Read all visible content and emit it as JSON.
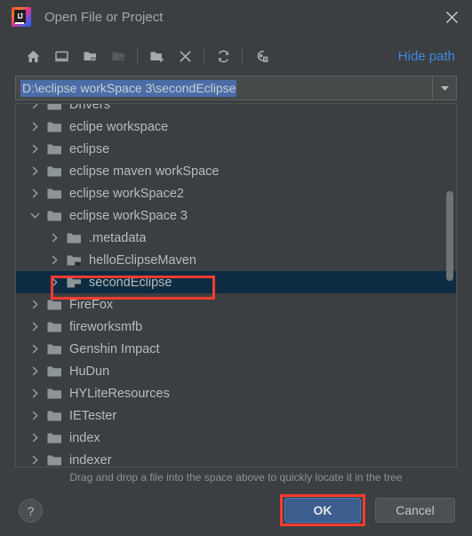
{
  "window": {
    "title": "Open File or Project",
    "logo_text": "IJ",
    "close_icon": "close-icon"
  },
  "toolbar": {
    "items": [
      {
        "name": "home-icon",
        "tooltip": "Home",
        "disabled": false
      },
      {
        "name": "desktop-icon",
        "tooltip": "Desktop",
        "disabled": false
      },
      {
        "name": "folder-up-icon",
        "tooltip": "Up",
        "disabled": false
      },
      {
        "name": "folder-icon",
        "tooltip": "Project Directory",
        "disabled": true
      },
      {
        "name": "new-folder-icon",
        "tooltip": "New Folder",
        "disabled": false
      },
      {
        "name": "delete-icon",
        "tooltip": "Delete",
        "disabled": false
      },
      {
        "name": "refresh-icon",
        "tooltip": "Refresh",
        "disabled": false
      },
      {
        "name": "show-hidden-files-icon",
        "tooltip": "Show Hidden Files",
        "disabled": false
      }
    ],
    "hide_path_label": "Hide path"
  },
  "path_field": {
    "value": "D:\\eclipse workSpace 3\\secondEclipse",
    "placeholder": "",
    "selected": true,
    "dropdown_icon": "chevron-down-icon"
  },
  "tree": {
    "rows": [
      {
        "label": "Drivers",
        "indent": 0,
        "expanded": false,
        "selected": false,
        "module": false,
        "clipped": true
      },
      {
        "label": "eclipe workspace",
        "indent": 0,
        "expanded": false,
        "selected": false,
        "module": false,
        "clipped": false
      },
      {
        "label": "eclipse",
        "indent": 0,
        "expanded": false,
        "selected": false,
        "module": false,
        "clipped": false
      },
      {
        "label": "eclipse maven workSpace",
        "indent": 0,
        "expanded": false,
        "selected": false,
        "module": false,
        "clipped": false
      },
      {
        "label": "eclipse workSpace2",
        "indent": 0,
        "expanded": false,
        "selected": false,
        "module": false,
        "clipped": false
      },
      {
        "label": "eclipse workSpace 3",
        "indent": 0,
        "expanded": true,
        "selected": false,
        "module": false,
        "clipped": false
      },
      {
        "label": ".metadata",
        "indent": 1,
        "expanded": false,
        "selected": false,
        "module": false,
        "clipped": false
      },
      {
        "label": "helloEclipseMaven",
        "indent": 1,
        "expanded": false,
        "selected": false,
        "module": true,
        "clipped": false
      },
      {
        "label": "secondEclipse",
        "indent": 1,
        "expanded": false,
        "selected": true,
        "module": true,
        "clipped": false
      },
      {
        "label": "FireFox",
        "indent": 0,
        "expanded": false,
        "selected": false,
        "module": false,
        "clipped": false
      },
      {
        "label": "fireworksmfb",
        "indent": 0,
        "expanded": false,
        "selected": false,
        "module": false,
        "clipped": false
      },
      {
        "label": "Genshin Impact",
        "indent": 0,
        "expanded": false,
        "selected": false,
        "module": false,
        "clipped": false
      },
      {
        "label": "HuDun",
        "indent": 0,
        "expanded": false,
        "selected": false,
        "module": false,
        "clipped": false
      },
      {
        "label": "HYLiteResources",
        "indent": 0,
        "expanded": false,
        "selected": false,
        "module": false,
        "clipped": false
      },
      {
        "label": "IETester",
        "indent": 0,
        "expanded": false,
        "selected": false,
        "module": false,
        "clipped": false
      },
      {
        "label": "index",
        "indent": 0,
        "expanded": false,
        "selected": false,
        "module": false,
        "clipped": false
      },
      {
        "label": "indexer",
        "indent": 0,
        "expanded": false,
        "selected": false,
        "module": false,
        "clipped": false
      }
    ]
  },
  "hint": "Drag and drop a file into the space above to quickly locate it in the tree",
  "footer": {
    "help_label": "?",
    "ok_label": "OK",
    "cancel_label": "Cancel"
  },
  "colors": {
    "dialog_background": "#3c3f41",
    "selection": "#0e2c41",
    "link": "#3f86e0",
    "default_button": "#3c5e8e",
    "annotation": "#ff3b30",
    "text_selection": "#4a6da7"
  }
}
